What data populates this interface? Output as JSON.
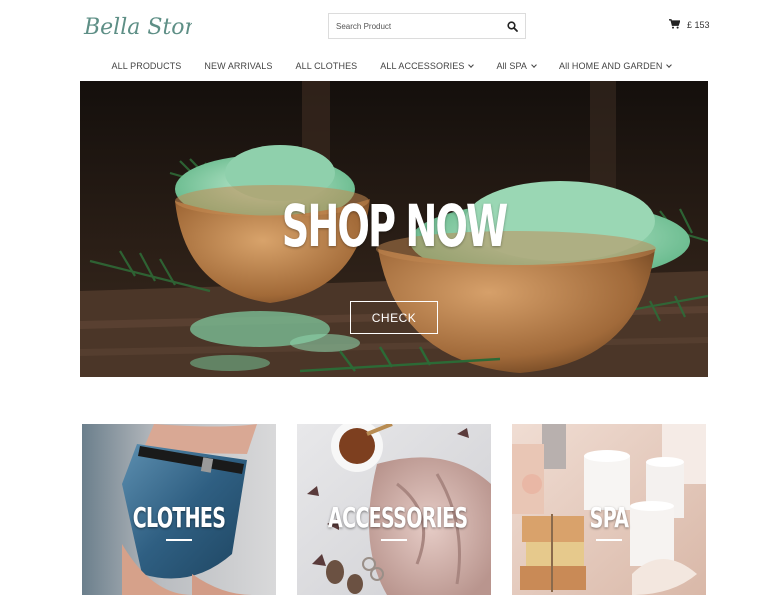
{
  "header": {
    "logo_text": "Bella Store",
    "search": {
      "placeholder": "Search Product"
    },
    "cart": {
      "amount": "£ 153"
    }
  },
  "nav": {
    "items": [
      {
        "label": "ALL PRODUCTS",
        "dropdown": false
      },
      {
        "label": "NEW ARRIVALS",
        "dropdown": false
      },
      {
        "label": "ALL CLOTHES",
        "dropdown": false
      },
      {
        "label": "ALL ACCESSORIES",
        "dropdown": true
      },
      {
        "label": "All SPA",
        "dropdown": true
      },
      {
        "label": "All HOME AND GARDEN",
        "dropdown": true
      }
    ]
  },
  "hero": {
    "title": "SHOP NOW",
    "button_label": "CHECK"
  },
  "categories": [
    {
      "label": "CLOTHES"
    },
    {
      "label": "ACCESSORIES"
    },
    {
      "label": "SPA"
    }
  ],
  "colors": {
    "logo": "#5e8f86",
    "text": "#333333",
    "hero_salt": "#86c9a3",
    "wood": "#b07a45"
  },
  "icons": {
    "search": "search-icon",
    "cart": "cart-icon",
    "dropdown": "chevron-down-icon"
  }
}
